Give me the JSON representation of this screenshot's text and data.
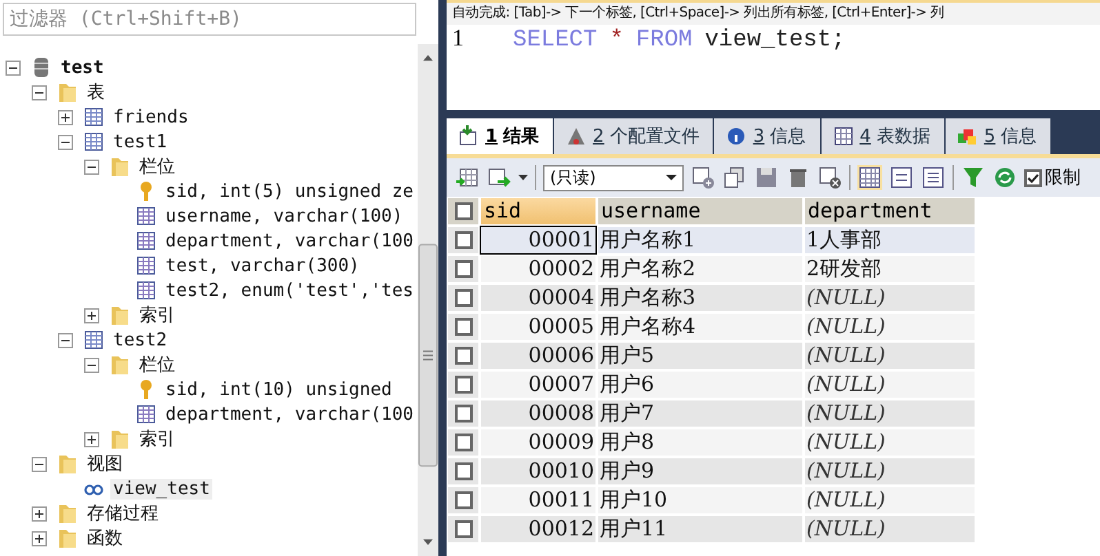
{
  "filter": {
    "placeholder": "过滤器 (Ctrl+Shift+B)"
  },
  "tree": [
    {
      "label": "test",
      "kind": "database",
      "expanded": true,
      "children": [
        {
          "label": "表",
          "kind": "folder",
          "expanded": true,
          "children": [
            {
              "label": "friends",
              "kind": "table",
              "expanded": false
            },
            {
              "label": "test1",
              "kind": "table",
              "expanded": true,
              "children": [
                {
                  "label": "栏位",
                  "kind": "folder",
                  "expanded": true,
                  "children": [
                    {
                      "label": "sid, int(5) unsigned ze",
                      "kind": "key"
                    },
                    {
                      "label": "username, varchar(100)",
                      "kind": "column"
                    },
                    {
                      "label": "department, varchar(100",
                      "kind": "column"
                    },
                    {
                      "label": "test, varchar(300)",
                      "kind": "column"
                    },
                    {
                      "label": "test2, enum('test','tes",
                      "kind": "column"
                    }
                  ]
                },
                {
                  "label": "索引",
                  "kind": "folder",
                  "expanded": false
                }
              ]
            },
            {
              "label": "test2",
              "kind": "table",
              "expanded": true,
              "children": [
                {
                  "label": "栏位",
                  "kind": "folder",
                  "expanded": true,
                  "children": [
                    {
                      "label": "sid, int(10) unsigned",
                      "kind": "key"
                    },
                    {
                      "label": "department, varchar(100",
                      "kind": "column"
                    }
                  ]
                },
                {
                  "label": "索引",
                  "kind": "folder",
                  "expanded": false
                }
              ]
            }
          ]
        },
        {
          "label": "视图",
          "kind": "folder",
          "expanded": true,
          "children": [
            {
              "label": "view_test",
              "kind": "view",
              "selected": true
            }
          ]
        },
        {
          "label": "存储过程",
          "kind": "folder",
          "expanded": false
        },
        {
          "label": "函数",
          "kind": "folder",
          "expanded": false
        }
      ]
    }
  ],
  "autocomplete": "自动完成: [Tab]-> 下一个标签, [Ctrl+Space]-> 列出所有标签, [Ctrl+Enter]-> 列",
  "editor": {
    "lines": [
      {
        "number": "1",
        "tokens": [
          {
            "kind": "keyword",
            "text": "SELECT"
          },
          {
            "kind": "operator",
            "text": "*"
          },
          {
            "kind": "keyword",
            "text": "FROM"
          },
          {
            "kind": "identifier",
            "text": "view_test;"
          }
        ]
      }
    ]
  },
  "tabs": [
    {
      "key": "1",
      "label": "结果",
      "kind": "result",
      "selected": true
    },
    {
      "key": "2",
      "label": "个配置文件",
      "kind": "profile",
      "selected": false
    },
    {
      "key": "3",
      "label": "信息",
      "kind": "info",
      "selected": false
    },
    {
      "key": "4",
      "label": "表数据",
      "kind": "grid",
      "selected": false
    },
    {
      "key": "5",
      "label": "信息",
      "kind": "blocks",
      "selected": false
    }
  ],
  "toolbar": {
    "mode": "(只读)",
    "limit": {
      "label": "限制",
      "checked": true
    }
  },
  "grid": {
    "select_all": {
      "checked": false
    },
    "columns": [
      {
        "label": "sid",
        "sorted": true
      },
      {
        "label": "username",
        "sorted": false
      },
      {
        "label": "department",
        "sorted": false
      }
    ],
    "rows": [
      {
        "selected": true,
        "checked": false,
        "cells": [
          {
            "kind": "text",
            "text": "00001"
          },
          {
            "kind": "text",
            "text": "用户名称1"
          },
          {
            "kind": "text",
            "text": "1人事部"
          }
        ]
      },
      {
        "selected": false,
        "checked": false,
        "cells": [
          {
            "kind": "text",
            "text": "00002"
          },
          {
            "kind": "text",
            "text": "用户名称2"
          },
          {
            "kind": "text",
            "text": "2研发部"
          }
        ]
      },
      {
        "selected": false,
        "checked": false,
        "cells": [
          {
            "kind": "text",
            "text": "00004"
          },
          {
            "kind": "text",
            "text": "用户名称3"
          },
          {
            "kind": "null",
            "text": "(NULL)"
          }
        ]
      },
      {
        "selected": false,
        "checked": false,
        "cells": [
          {
            "kind": "text",
            "text": "00005"
          },
          {
            "kind": "text",
            "text": "用户名称4"
          },
          {
            "kind": "null",
            "text": "(NULL)"
          }
        ]
      },
      {
        "selected": false,
        "checked": false,
        "cells": [
          {
            "kind": "text",
            "text": "00006"
          },
          {
            "kind": "text",
            "text": "用户5"
          },
          {
            "kind": "null",
            "text": "(NULL)"
          }
        ]
      },
      {
        "selected": false,
        "checked": false,
        "cells": [
          {
            "kind": "text",
            "text": "00007"
          },
          {
            "kind": "text",
            "text": "用户6"
          },
          {
            "kind": "null",
            "text": "(NULL)"
          }
        ]
      },
      {
        "selected": false,
        "checked": false,
        "cells": [
          {
            "kind": "text",
            "text": "00008"
          },
          {
            "kind": "text",
            "text": "用户7"
          },
          {
            "kind": "null",
            "text": "(NULL)"
          }
        ]
      },
      {
        "selected": false,
        "checked": false,
        "cells": [
          {
            "kind": "text",
            "text": "00009"
          },
          {
            "kind": "text",
            "text": "用户8"
          },
          {
            "kind": "null",
            "text": "(NULL)"
          }
        ]
      },
      {
        "selected": false,
        "checked": false,
        "cells": [
          {
            "kind": "text",
            "text": "00010"
          },
          {
            "kind": "text",
            "text": "用户9"
          },
          {
            "kind": "null",
            "text": "(NULL)"
          }
        ]
      },
      {
        "selected": false,
        "checked": false,
        "cells": [
          {
            "kind": "text",
            "text": "00011"
          },
          {
            "kind": "text",
            "text": "用户10"
          },
          {
            "kind": "null",
            "text": "(NULL)"
          }
        ]
      },
      {
        "selected": false,
        "checked": false,
        "cells": [
          {
            "kind": "text",
            "text": "00012"
          },
          {
            "kind": "text",
            "text": "用户11"
          },
          {
            "kind": "null",
            "text": "(NULL)"
          }
        ]
      }
    ]
  }
}
